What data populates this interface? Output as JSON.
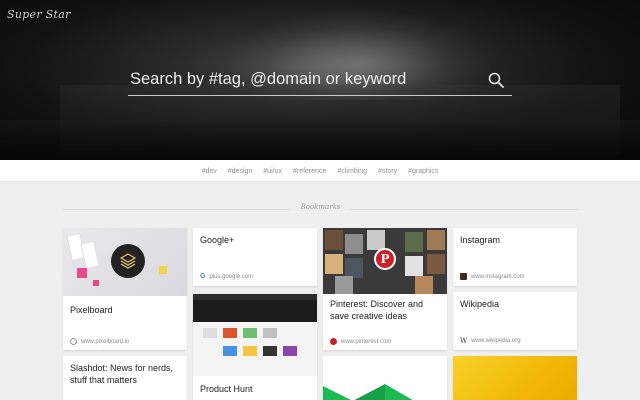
{
  "app": {
    "brand": "Super Star"
  },
  "search": {
    "placeholder": "Search by #tag, @domain or keyword"
  },
  "tags": [
    "#dev",
    "#design",
    "#ui/ux",
    "#reference",
    "#climbing",
    "#story",
    "#graphics"
  ],
  "section": {
    "label": "Bookmarks"
  },
  "cards": {
    "pixelboard": {
      "title": "Pixelboard",
      "domain": "www.pixelboard.io"
    },
    "google": {
      "title": "Google+",
      "domain": "plus.google.com"
    },
    "pinterest": {
      "title": "Pinterest: Discover and save creative ideas",
      "domain": "www.pinterest.com"
    },
    "instagram": {
      "title": "Instagram",
      "domain": "www.instagram.com"
    },
    "wikipedia": {
      "title": "Wikipedia",
      "domain": "www.wikipedia.org"
    },
    "slashdot": {
      "title": "Slashdot: News for nerds, stuff that matters"
    },
    "producthunt": {
      "title": "Product Hunt"
    }
  },
  "colors": {
    "pinterest": "#cb2027",
    "google": "#4285f4",
    "pixelboard_accent": "#e84a8c",
    "yellow": "#f2b807",
    "green": "#1db954"
  },
  "icons": {
    "search": "magnifier-icon",
    "pinterest": "pinterest-p-icon",
    "wikipedia": "w-icon",
    "instagram": "camera-icon",
    "google": "g-icon",
    "pixelboard": "layers-icon"
  }
}
